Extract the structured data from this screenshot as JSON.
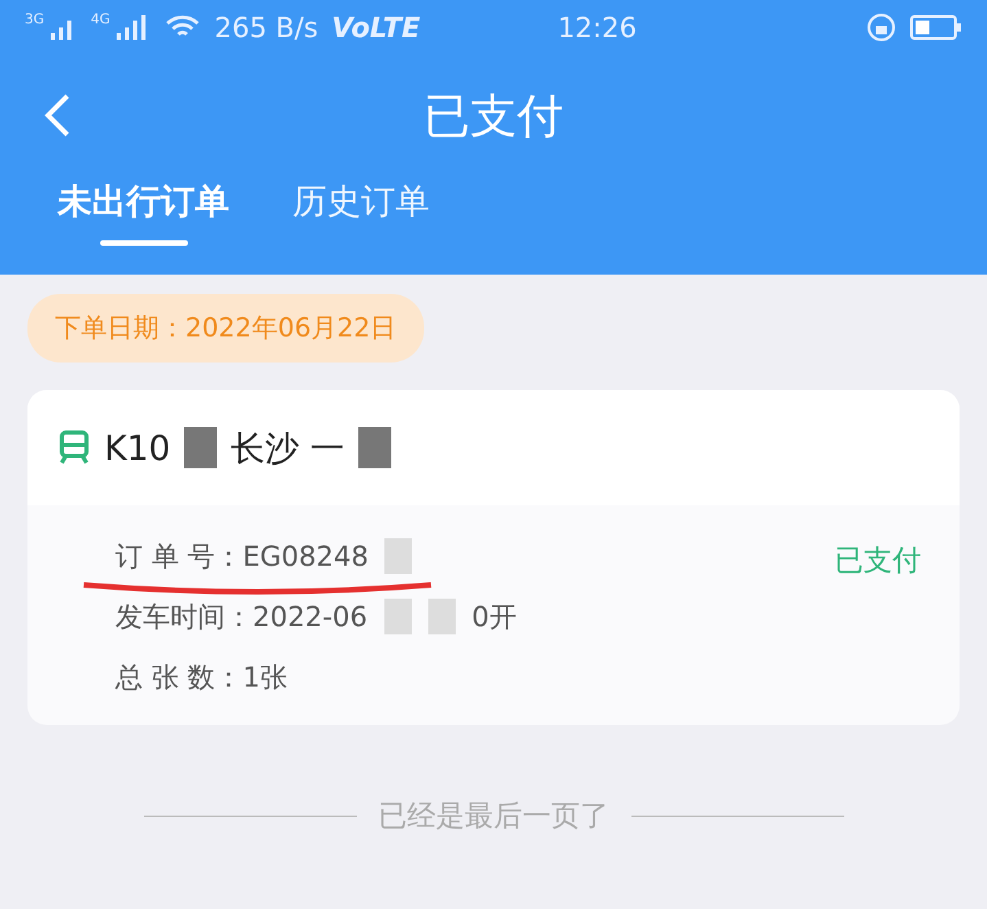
{
  "status_bar": {
    "net1": "3G",
    "net2": "4G",
    "speed": "265 B/s",
    "volte": "VoLTE",
    "time": "12:26"
  },
  "header": {
    "title": "已支付"
  },
  "tabs": [
    {
      "label": "未出行订单",
      "selected": true
    },
    {
      "label": "历史订单",
      "selected": false
    }
  ],
  "order_date": "下单日期：2022年06月22日",
  "order": {
    "train": "K10",
    "route": "长沙 一",
    "status": "已支付",
    "lines": [
      {
        "label": "订 单 号：",
        "value": "EG08248",
        "underlined": true
      },
      {
        "label": "发车时间：",
        "value": "2022-06",
        "tail": "0开",
        "underlined": false
      },
      {
        "label": "总 张 数：",
        "value": "1张",
        "underlined": false
      }
    ]
  },
  "footer": "已经是最后一页了"
}
